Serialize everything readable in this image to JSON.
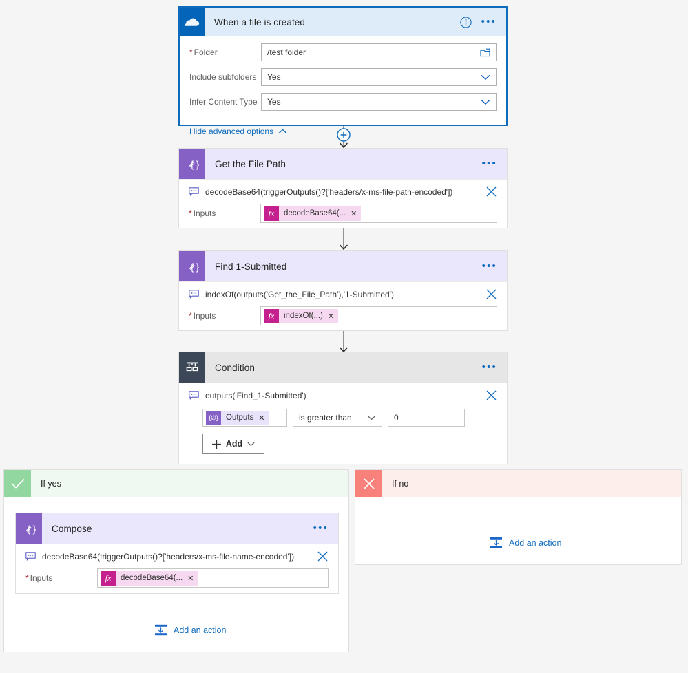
{
  "trigger": {
    "title": "When a file is created",
    "icon": "onedrive-cloud-icon",
    "info_icon": "info-icon",
    "menu_icon": "ellipsis-icon",
    "fields": [
      {
        "label": "Folder",
        "required": true,
        "value": "/test folder",
        "control": "folder-picker"
      },
      {
        "label": "Include subfolders",
        "required": false,
        "value": "Yes",
        "control": "dropdown"
      },
      {
        "label": "Infer Content Type",
        "required": false,
        "value": "Yes",
        "control": "dropdown"
      }
    ],
    "advanced_link": "Hide advanced options"
  },
  "get_file_path": {
    "title": "Get the File Path",
    "expression": "decodeBase64(triggerOutputs()?['headers/x-ms-file-path-encoded'])",
    "inputs_label": "Inputs",
    "chip": "decodeBase64(...",
    "chip_badge": "fx",
    "menu_icon": "ellipsis-icon"
  },
  "find_submitted": {
    "title": "Find 1-Submitted",
    "expression": "indexOf(outputs('Get_the_File_Path'),'1-Submitted')",
    "inputs_label": "Inputs",
    "chip": "indexOf(...)",
    "chip_badge": "fx",
    "menu_icon": "ellipsis-icon"
  },
  "condition": {
    "title": "Condition",
    "expression": "outputs('Find_1-Submitted')",
    "token": "Outputs",
    "operator": "is greater than",
    "value": "0",
    "add_label": "Add",
    "menu_icon": "ellipsis-icon"
  },
  "if_yes": {
    "title": "If yes",
    "badge_icon": "check-icon",
    "add_action_label": "Add an action"
  },
  "if_no": {
    "title": "If no",
    "badge_icon": "close-icon",
    "add_action_label": "Add an action"
  },
  "compose": {
    "title": "Compose",
    "expression": "decodeBase64(triggerOutputs()?['headers/x-ms-file-name-encoded'])",
    "inputs_label": "Inputs",
    "chip": "decodeBase64(...",
    "chip_badge": "fx",
    "menu_icon": "ellipsis-icon"
  },
  "colors": {
    "trigger_border": "#0f6cbd",
    "trigger_header": "#deecf9",
    "compose_purple": "#8661c5",
    "condition_dark": "#3c4858",
    "yes_green": "#92d6a0",
    "no_red": "#f8827b",
    "accent_link": "#0f6cbd",
    "fx_magenta": "#c4218f",
    "required_red": "#a4262c"
  }
}
